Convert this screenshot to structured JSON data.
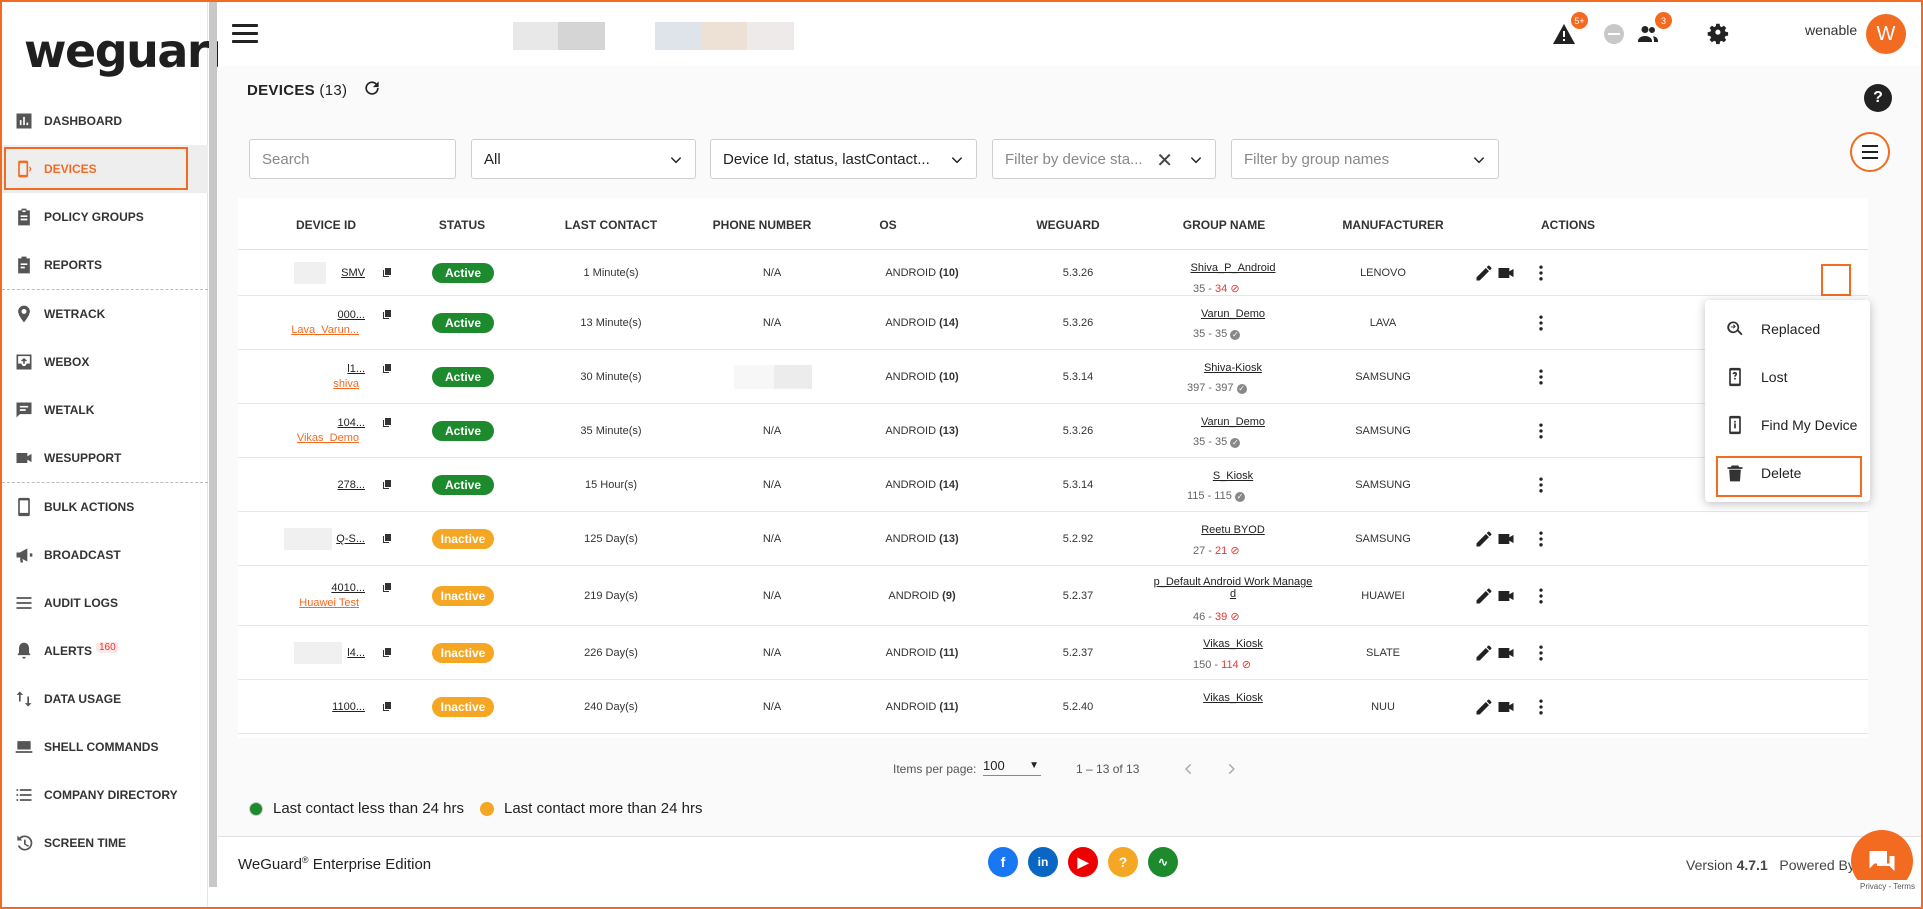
{
  "brand": {
    "logo_text": "weguard"
  },
  "sidebar": {
    "items": [
      {
        "label": "DASHBOARD",
        "icon": "bar-chart-icon"
      },
      {
        "label": "DEVICES",
        "icon": "devices-icon"
      },
      {
        "label": "POLICY GROUPS",
        "icon": "clipboard-icon"
      },
      {
        "label": "REPORTS",
        "icon": "report-icon"
      },
      {
        "label": "WETRACK",
        "icon": "location-pin-icon"
      },
      {
        "label": "WEBOX",
        "icon": "inbox-icon"
      },
      {
        "label": "WETALK",
        "icon": "chat-icon"
      },
      {
        "label": "WESUPPORT",
        "icon": "video-camera-icon"
      },
      {
        "label": "BULK ACTIONS",
        "icon": "phone-icon"
      },
      {
        "label": "BROADCAST",
        "icon": "megaphone-icon"
      },
      {
        "label": "AUDIT LOGS",
        "icon": "list-icon"
      },
      {
        "label": "ALERTS",
        "icon": "bell-icon",
        "badge": "160"
      },
      {
        "label": "DATA USAGE",
        "icon": "swap-vertical-icon"
      },
      {
        "label": "SHELL COMMANDS",
        "icon": "laptop-icon"
      },
      {
        "label": "COMPANY DIRECTORY",
        "icon": "list-bullet-icon"
      },
      {
        "label": "SCREEN TIME",
        "icon": "history-icon"
      }
    ]
  },
  "topbar": {
    "alerts_badge": "5+",
    "users_badge": "3",
    "username": "wenable",
    "avatar_letter": "W"
  },
  "page": {
    "title": "DEVICES",
    "count": "(13)"
  },
  "filters": {
    "search_placeholder": "Search",
    "all_value": "All",
    "columns_value": "Device Id, status, lastContact...",
    "device_state_placeholder": "Filter by device sta...",
    "group_placeholder": "Filter by group names"
  },
  "table": {
    "headers": [
      "DEVICE ID",
      "STATUS",
      "LAST CONTACT",
      "PHONE NUMBER",
      "OS",
      "WEGUARD",
      "GROUP NAME",
      "MANUFACTURER",
      "ACTIONS"
    ],
    "rows": [
      {
        "device_id": "SMV",
        "sub": "",
        "status": "Active",
        "last_contact": "1 Minute(s)",
        "phone": "N/A",
        "os": "ANDROID",
        "os_ver": "(10)",
        "weguard": "5.3.26",
        "group": "Shiva_P_Android",
        "group2": "",
        "cnt_a": "35 - ",
        "cnt_b": "34",
        "cnt_ok": false,
        "manufacturer": "LENOVO"
      },
      {
        "device_id": "000...",
        "sub": "Lava_Varun...",
        "status": "Active",
        "last_contact": "13 Minute(s)",
        "phone": "N/A",
        "os": "ANDROID",
        "os_ver": "(14)",
        "weguard": "5.3.26",
        "group": "Varun_Demo",
        "group2": "",
        "cnt_a": "35 - 35",
        "cnt_b": "",
        "cnt_ok": true,
        "manufacturer": "LAVA"
      },
      {
        "device_id": "l1...",
        "sub": "shiva",
        "status": "Active",
        "last_contact": "30 Minute(s)",
        "phone": "",
        "os": "ANDROID",
        "os_ver": "(10)",
        "weguard": "5.3.14",
        "group": "Shiva-Kiosk",
        "group2": "",
        "cnt_a": "397 - 397",
        "cnt_b": "",
        "cnt_ok": true,
        "manufacturer": "SAMSUNG"
      },
      {
        "device_id": "104...",
        "sub": "Vikas_Demo",
        "status": "Active",
        "last_contact": "35 Minute(s)",
        "phone": "N/A",
        "os": "ANDROID",
        "os_ver": "(13)",
        "weguard": "5.3.26",
        "group": "Varun_Demo",
        "group2": "",
        "cnt_a": "35 - 35",
        "cnt_b": "",
        "cnt_ok": true,
        "manufacturer": "SAMSUNG"
      },
      {
        "device_id": "278...",
        "sub": "",
        "status": "Active",
        "last_contact": "15 Hour(s)",
        "phone": "N/A",
        "os": "ANDROID",
        "os_ver": "(14)",
        "weguard": "5.3.14",
        "group": "S_Kiosk",
        "group2": "",
        "cnt_a": "115 - 115",
        "cnt_b": "",
        "cnt_ok": true,
        "manufacturer": "SAMSUNG"
      },
      {
        "device_id": "Q-S...",
        "sub": "",
        "status": "Inactive",
        "last_contact": "125 Day(s)",
        "phone": "N/A",
        "os": "ANDROID",
        "os_ver": "(13)",
        "weguard": "5.2.92",
        "group": "Reetu BYOD",
        "group2": "",
        "cnt_a": "27 - ",
        "cnt_b": "21",
        "cnt_ok": false,
        "manufacturer": "SAMSUNG"
      },
      {
        "device_id": "4010...",
        "sub": "Huawei Test",
        "status": "Inactive",
        "last_contact": "219 Day(s)",
        "phone": "N/A",
        "os": "ANDROID",
        "os_ver": "(9)",
        "weguard": "5.2.37",
        "group": "p_Default Android Work Manage",
        "group2": "d",
        "cnt_a": "46 - ",
        "cnt_b": "39",
        "cnt_ok": false,
        "manufacturer": "HUAWEI"
      },
      {
        "device_id": "l4...",
        "sub": "",
        "status": "Inactive",
        "last_contact": "226 Day(s)",
        "phone": "N/A",
        "os": "ANDROID",
        "os_ver": "(11)",
        "weguard": "5.2.37",
        "group": "Vikas_Kiosk",
        "group2": "",
        "cnt_a": "150 - ",
        "cnt_b": "114",
        "cnt_ok": false,
        "manufacturer": "SLATE"
      },
      {
        "device_id": "1100...",
        "sub": "",
        "status": "Inactive",
        "last_contact": "240 Day(s)",
        "phone": "N/A",
        "os": "ANDROID",
        "os_ver": "(11)",
        "weguard": "5.2.40",
        "group": "Vikas_Kiosk",
        "group2": "",
        "cnt_a": "",
        "cnt_b": "",
        "cnt_ok": false,
        "manufacturer": "NUU"
      }
    ]
  },
  "dropdown": {
    "items": [
      {
        "label": "Replaced",
        "icon": "replace-icon"
      },
      {
        "label": "Lost",
        "icon": "lost-phone-icon"
      },
      {
        "label": "Find My Device",
        "icon": "find-device-icon"
      },
      {
        "label": "Delete",
        "icon": "trash-icon"
      }
    ]
  },
  "pagination": {
    "items_per_page_label": "Items per page:",
    "items_per_page_value": "100",
    "range": "1 – 13 of 13"
  },
  "legend": {
    "green_label": "Last contact less than 24 hrs",
    "orange_label": "Last contact more than 24 hrs"
  },
  "footer": {
    "brand": "WeGuard",
    "reg": "®",
    "edition": " Enterprise Edition",
    "version_label": "Version ",
    "version": "4.7.1",
    "powered": "Powered By",
    "recaptcha": "Privacy - Terms"
  },
  "colors": {
    "accent": "#f26b21",
    "active": "#1d8a2d",
    "inactive": "#f5a623"
  }
}
